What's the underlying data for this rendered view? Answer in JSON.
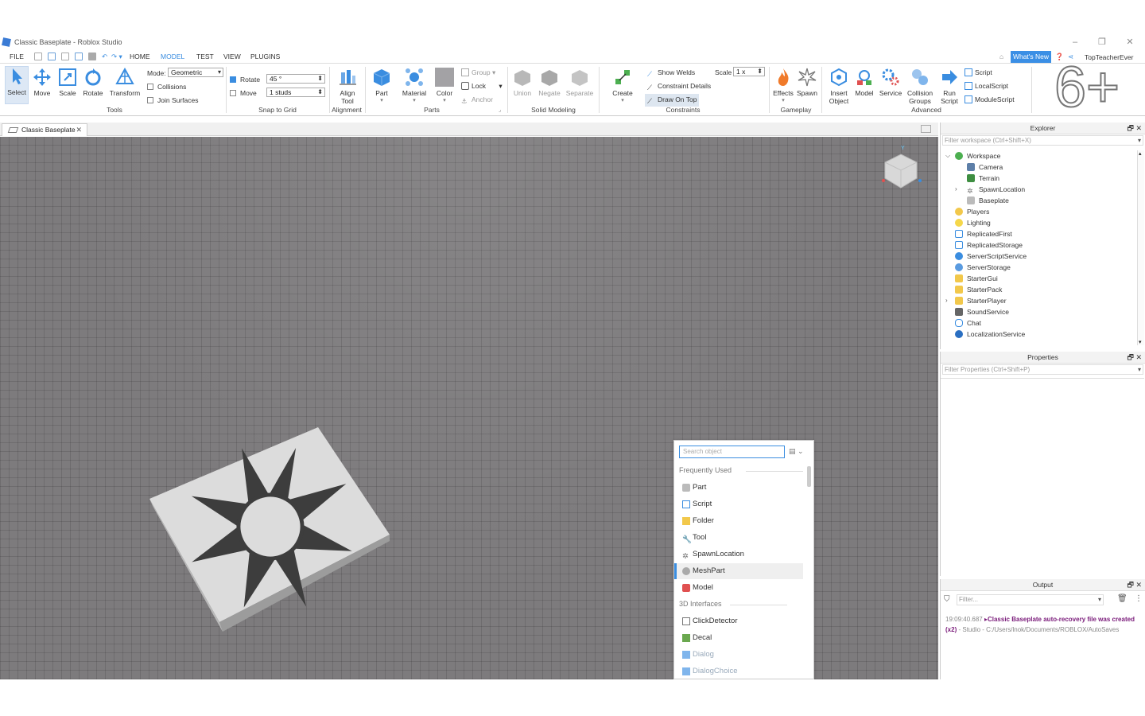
{
  "window": {
    "title": "Classic Baseplate - Roblox Studio"
  },
  "menu": {
    "file": "FILE",
    "home": "HOME",
    "model": "MODEL",
    "test": "TEST",
    "view": "VIEW",
    "plugins": "PLUGINS",
    "whats_new": "What's New",
    "user": "TopTeacherEver"
  },
  "ribbon": {
    "tools": {
      "select": "Select",
      "move": "Move",
      "scale": "Scale",
      "rotate": "Rotate",
      "transform": "Transform",
      "group_label": "Tools"
    },
    "mode": {
      "label": "Mode:",
      "value": "Geometric",
      "collisions": "Collisions",
      "join_surfaces": "Join Surfaces"
    },
    "snap": {
      "rotate_label": "Rotate",
      "rotate_value": "45 °",
      "move_label": "Move",
      "move_value": "1 studs",
      "group_label": "Snap to Grid"
    },
    "alignment": {
      "align_tool": "Align Tool",
      "group_label": "Alignment"
    },
    "parts": {
      "part": "Part",
      "material": "Material",
      "color": "Color",
      "group": "Group",
      "lock": "Lock",
      "anchor": "Anchor",
      "group_label": "Parts"
    },
    "solid_modeling": {
      "union": "Union",
      "negate": "Negate",
      "separate": "Separate",
      "group_label": "Solid Modeling"
    },
    "constraints": {
      "create": "Create",
      "show_welds": "Show Welds",
      "constraint_details": "Constraint Details",
      "draw_on_top": "Draw On Top",
      "scale_label": "Scale",
      "scale_value": "1 x",
      "group_label": "Constraints"
    },
    "gameplay": {
      "effects": "Effects",
      "spawn": "Spawn",
      "group_label": "Gameplay"
    },
    "advanced": {
      "insert_object": "Insert Object",
      "model": "Model",
      "service": "Service",
      "collision_groups": "Collision Groups",
      "run_script": "Run Script",
      "script": "Script",
      "local_script": "LocalScript",
      "module_script": "ModuleScript",
      "group_label": "Advanced"
    },
    "overlay_text": "6+"
  },
  "doc_tab": {
    "label": "Classic Baseplate"
  },
  "insert_popup": {
    "search_placeholder": "Search object",
    "frequently_used": "Frequently Used",
    "items_freq": [
      "Part",
      "Script",
      "Folder",
      "Tool",
      "SpawnLocation",
      "MeshPart",
      "Model"
    ],
    "interfaces_3d": "3D Interfaces",
    "items_3d": [
      "ClickDetector",
      "Decal",
      "Dialog",
      "DialogChoice"
    ]
  },
  "explorer": {
    "title": "Explorer",
    "filter_placeholder": "Filter workspace (Ctrl+Shift+X)",
    "items": [
      "Workspace",
      "Camera",
      "Terrain",
      "SpawnLocation",
      "Baseplate",
      "Players",
      "Lighting",
      "ReplicatedFirst",
      "ReplicatedStorage",
      "ServerScriptService",
      "ServerStorage",
      "StarterGui",
      "StarterPack",
      "StarterPlayer",
      "SoundService",
      "Chat",
      "LocalizationService"
    ]
  },
  "properties": {
    "title": "Properties",
    "filter_placeholder": "Filter Properties (Ctrl+Shift+P)"
  },
  "output": {
    "title": "Output",
    "filter_placeholder": "Filter...",
    "timestamp": "19:09:40.687",
    "message": "▸Classic Baseplate auto-recovery file was created",
    "count": "(x2)",
    "source": "- Studio - C:/Users/lnok/Documents/ROBLOX/AutoSaves"
  },
  "colors": {
    "accent": "#3a8de0",
    "viewport": "#7d7b7d",
    "whats_new_bg": "#3b8fe5"
  }
}
